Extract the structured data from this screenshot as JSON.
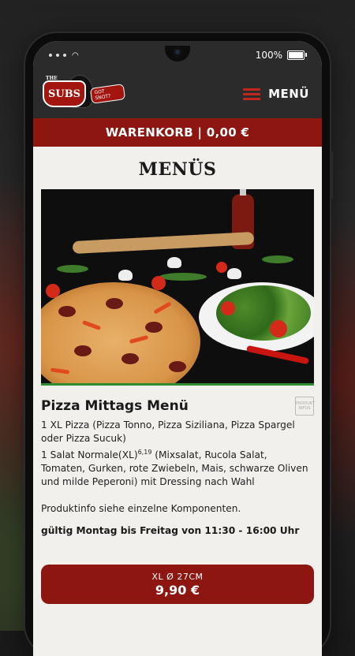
{
  "status_bar": {
    "battery": "100%"
  },
  "header": {
    "logo": {
      "name": "SUBS",
      "small": "THE",
      "tag": "GOT SNOT?"
    },
    "menu_label": "MENÜ"
  },
  "cart": {
    "label": "WARENKORB | 0,00 €"
  },
  "page": {
    "title": "MENÜS"
  },
  "product": {
    "title": "Pizza Mittags Menü",
    "info_icon_text": "PRODUKT INFOS",
    "line1": "1 XL Pizza (Pizza Tonno, Pizza Siziliana, Pizza Spargel oder Pizza Sucuk)",
    "line2_prefix": "1 Salat Normale(XL)",
    "line2_sup": "6,19",
    "line2_rest": " (Mixsalat, Rucola Salat, Tomaten, Gurken, rote Zwiebeln, Mais, schwarze Oliven und milde Peperoni) mit Dressing nach Wahl",
    "info_note": "Produktinfo siehe einzelne Komponenten.",
    "validity": "gültig Montag bis Freitag von 11:30 - 16:00 Uhr",
    "price_size": "XL Ø 27CM",
    "price": "9,90 €"
  },
  "colors": {
    "brand_red": "#8e1610",
    "header_dark": "#2b2b2b",
    "accent_green": "#2e8b2e"
  }
}
